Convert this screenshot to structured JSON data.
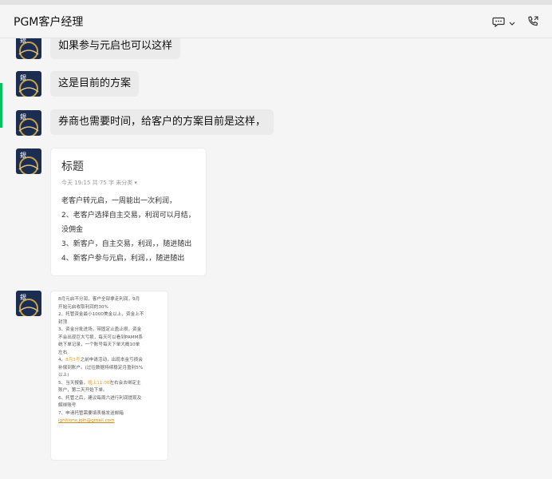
{
  "header": {
    "title": "PGM客户经理"
  },
  "icons": {
    "chat": "chat-bubble-icon",
    "chevron": "chevron-down-icon",
    "call": "phone-call-icon"
  },
  "colors": {
    "accent": "#07c160",
    "bubble": "#ebebeb",
    "highlight": "#f0a020"
  },
  "messages": [
    {
      "text": "如果参与元启也可以这样"
    },
    {
      "text": "这是目前的方案"
    },
    {
      "text": "券商也需要时间，给客户的方案目前是这样，"
    }
  ],
  "article": {
    "title": "标题",
    "meta": "今天 19:15  共 75 字  未分类 ▾",
    "lines": [
      "老客户转元启，一周能出一次利润，",
      "2、老客户选择自主交易，利润可以月结，",
      "没佣金",
      "3、新客户，自主交易，利润，，随进随出",
      "4、新客户参与元启，利润，，随进随出"
    ]
  },
  "image_text": {
    "lines": [
      "8月元启不分润，客户全部拿走利润，9月",
      "开始元启收取利润的30%",
      "2、托管资金最小1000美金以上，资金上不",
      "封顶",
      "3、资金分批进场，带固定止盈止损，资金",
      "不会出现巨大亏损，每天可以看到PAMM系",
      "统下单记录，一个账号每天下单大概10单",
      "左右",
      "之前申请活动，出现本金亏损会",
      "补偿到账户。(过往数据持续稳定月盈利5%",
      "以上)",
      "5、当天报备，",
      "左右会去绑定主",
      "账户，第二天开始下单。",
      "6、托管之后，建议每周六进行利润提现及",
      "解绑账号",
      "7、申请托管需要填表格发送邮箱",
      "ignitions.join@gmail.com"
    ],
    "hl_date": "8月3号",
    "hl_prefix": "4、",
    "hl_time": "晚上11:00"
  }
}
